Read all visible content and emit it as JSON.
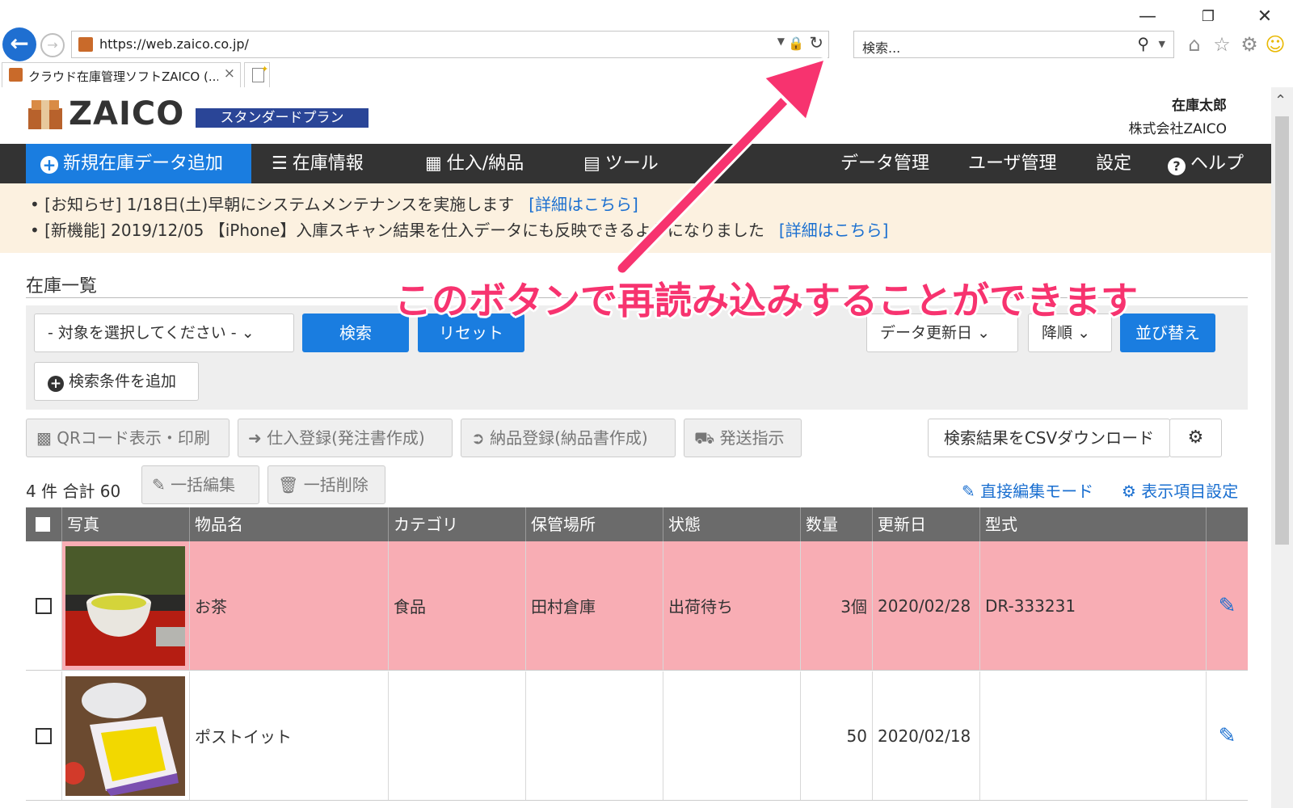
{
  "browser": {
    "address_url": "https://web.zaico.co.jp/",
    "search_placeholder": "検索...",
    "tab_title": "クラウド在庫管理ソフトZAICO (...",
    "window_controls": [
      "minimize-icon",
      "restore-icon",
      "close-icon"
    ],
    "toolbar_icons": [
      "home-icon",
      "favorites-star-icon",
      "gear-icon",
      "smiley-icon"
    ]
  },
  "header": {
    "logo_text": "ZAICO",
    "plan_label": "スタンダードプラン",
    "user_name": "在庫太郎",
    "company": "株式会社ZAICO"
  },
  "nav": {
    "add_label": "新規在庫データ追加",
    "inventory_label": "在庫情報",
    "purchase_label": "仕入/納品",
    "tools_label": "ツール",
    "data_label": "データ管理",
    "users_label": "ユーザ管理",
    "settings_label": "設定",
    "help_label": "ヘルプ"
  },
  "notices": [
    {
      "text": "[お知らせ] 1/18日(土)早朝にシステムメンテナンスを実施します",
      "link": "[詳細はこちら]"
    },
    {
      "text": "[新機能] 2019/12/05 【iPhone】入庫スキャン結果を仕入データにも反映できるようになりました",
      "link": "[詳細はこちら]"
    }
  ],
  "list": {
    "title": "在庫一覧",
    "target_select": "- 対象を選択してください -",
    "search_button": "検索",
    "reset_button": "リセット",
    "sort_field": "データ更新日",
    "sort_order": "降順",
    "sort_button": "並び替え",
    "add_condition": "検索条件を追加"
  },
  "actions": {
    "qr": "QRコード表示・印刷",
    "purchase": "仕入登録(発注書作成)",
    "delivery": "納品登録(納品書作成)",
    "shipping": "発送指示",
    "csv": "検索結果をCSVダウンロード",
    "bulk_edit": "一括編集",
    "bulk_delete": "一括削除",
    "direct_edit": "直接編集モード",
    "display_settings": "表示項目設定"
  },
  "summary": "4 件 合計 60",
  "table": {
    "columns": [
      "写真",
      "物品名",
      "カテゴリ",
      "保管場所",
      "状態",
      "数量",
      "更新日",
      "型式"
    ],
    "rows": [
      {
        "name": "お茶",
        "category": "食品",
        "location": "田村倉庫",
        "status": "出荷待ち",
        "quantity": "3個",
        "updated": "2020/02/28",
        "model": "DR-333231",
        "highlight": "#f8adb4"
      },
      {
        "name": "ポストイット",
        "category": "",
        "location": "",
        "status": "",
        "quantity": "50",
        "updated": "2020/02/18",
        "model": "",
        "highlight": "#ffffff"
      }
    ]
  },
  "annotation": {
    "text": "このボタンで再読み込みすることができます",
    "color": "#f7336f"
  }
}
